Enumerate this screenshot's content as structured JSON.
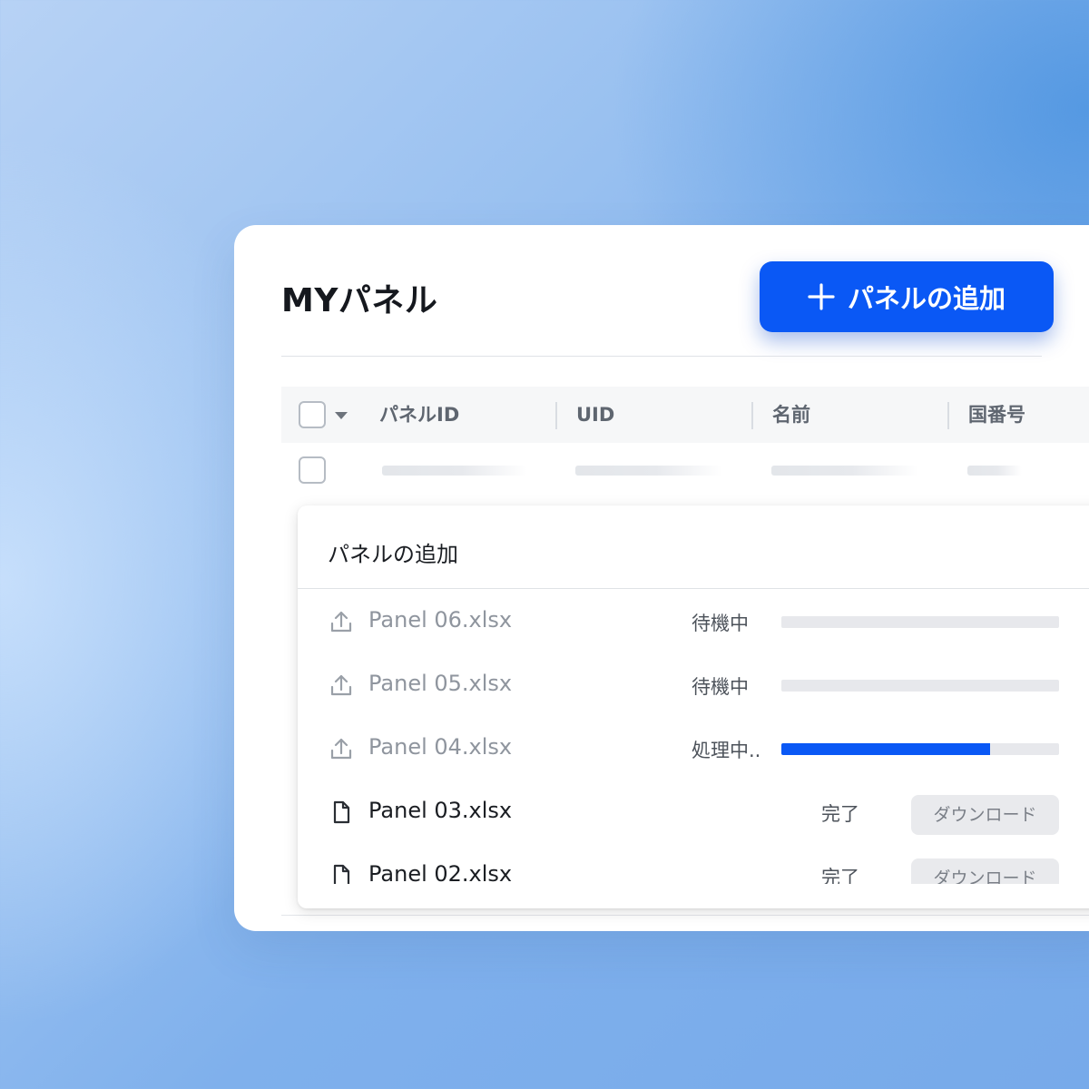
{
  "header": {
    "title": "MYパネル",
    "add_button_label": "パネルの追加",
    "add_button_icon": "plus-icon"
  },
  "table": {
    "columns": [
      "パネルID",
      "UID",
      "名前",
      "国番号"
    ]
  },
  "upload_panel": {
    "title": "パネルの追加",
    "files": [
      {
        "name": "Panel 06.xlsx",
        "status": "待機中",
        "progress": 0,
        "state": "waiting",
        "icon": "upload-icon"
      },
      {
        "name": "Panel 05.xlsx",
        "status": "待機中",
        "progress": 0,
        "state": "waiting",
        "icon": "upload-icon"
      },
      {
        "name": "Panel 04.xlsx",
        "status": "処理中..",
        "progress": 0.75,
        "state": "processing",
        "icon": "upload-icon"
      },
      {
        "name": "Panel 03.xlsx",
        "status": "完了",
        "action": "ダウンロード",
        "state": "done",
        "icon": "file-icon"
      },
      {
        "name": "Panel 02.xlsx",
        "status": "完了",
        "action": "ダウンロード",
        "state": "done",
        "icon": "file-icon"
      }
    ]
  },
  "colors": {
    "accent": "#0a58f5",
    "background": "#8fb9ef"
  }
}
